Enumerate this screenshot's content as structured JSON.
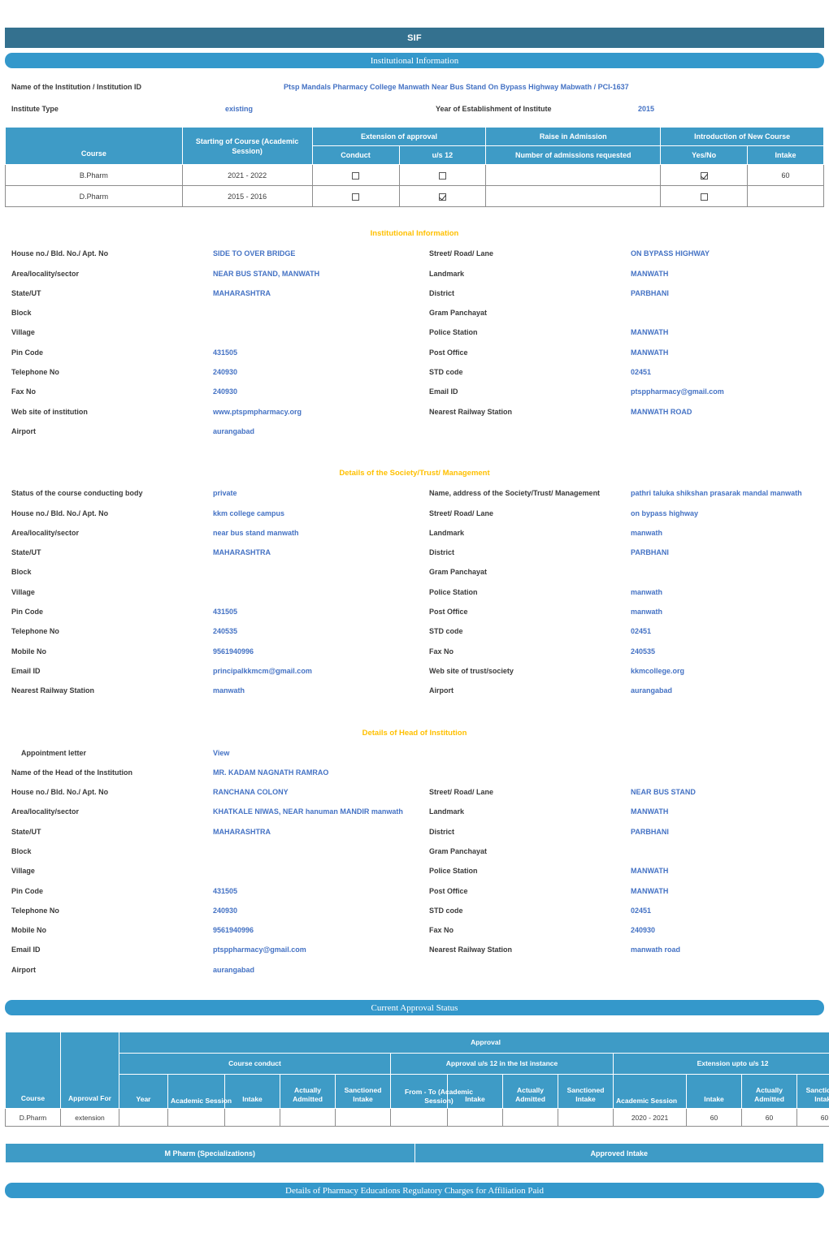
{
  "header": {
    "app_title": "SIF",
    "section_institutional": "Institutional Information"
  },
  "colors": {
    "title_bar": "#34718F",
    "section_bar": "#3498CB",
    "table_header": "#3E9BC6",
    "value_text": "#4472C4",
    "section_heading": "#FFC000",
    "link": "#4EA3D6"
  },
  "top": {
    "institution_label": "Name of the Institution / Institution ID",
    "institution_value": "Ptsp Mandals Pharmacy College Manwath Near Bus Stand On Bypass Highway Mabwath / PCI-1637",
    "institute_type_label": "Institute Type",
    "institute_type_value": "existing",
    "year_label": "Year of Establishment of Institute",
    "year_value": "2015"
  },
  "course_table": {
    "headers": {
      "course": "Course",
      "starting": "Starting of Course (Academic Session)",
      "extension": "Extension of approval",
      "conduct": "Conduct",
      "us12": "u/s 12",
      "raise": "Raise in Admission",
      "admissions_requested": "Number of admissions requested",
      "new_course": "Introduction of New Course",
      "yesno": "Yes/No",
      "intake": "Intake"
    },
    "rows": [
      {
        "course": "B.Pharm",
        "session": "2021 - 2022",
        "conduct": false,
        "us12": false,
        "admissions": "",
        "yesno": true,
        "intake": "60"
      },
      {
        "course": "D.Pharm",
        "session": "2015 - 2016",
        "conduct": false,
        "us12": true,
        "admissions": "",
        "yesno": false,
        "intake": ""
      }
    ]
  },
  "institutional_information": {
    "heading": "Institutional Information",
    "rows": [
      {
        "l1": "House no./ Bld. No./ Apt. No",
        "v1": "SIDE TO OVER BRIDGE",
        "l2": "Street/ Road/ Lane",
        "v2": "ON BYPASS HIGHWAY"
      },
      {
        "l1": "Area/locality/sector",
        "v1": "NEAR BUS STAND, MANWATH",
        "l2": "Landmark",
        "v2": "MANWATH"
      },
      {
        "l1": "State/UT",
        "v1": "MAHARASHTRA",
        "l2": "District",
        "v2": "PARBHANI"
      },
      {
        "l1": "Block",
        "v1": "",
        "l2": "Gram Panchayat",
        "v2": ""
      },
      {
        "l1": "Village",
        "v1": "",
        "l2": "Police Station",
        "v2": "MANWATH"
      },
      {
        "l1": "Pin Code",
        "v1": "431505",
        "l2": "Post Office",
        "v2": "MANWATH"
      },
      {
        "l1": "Telephone No",
        "v1": "240930",
        "l2": "STD code",
        "v2": "02451"
      },
      {
        "l1": "Fax No",
        "v1": "240930",
        "l2": "Email ID",
        "v2": "ptsppharmacy@gmail.com"
      },
      {
        "l1": "Web site of institution",
        "v1": "www.ptspmpharmacy.org",
        "l2": "Nearest Railway Station",
        "v2": "MANWATH ROAD"
      },
      {
        "l1": "Airport",
        "v1": "aurangabad",
        "l2": "",
        "v2": ""
      }
    ]
  },
  "society_details": {
    "heading": "Details of the Society/Trust/ Management",
    "rows": [
      {
        "l1": "Status of the course conducting body",
        "v1": "private",
        "l2": "Name, address of the Society/Trust/ Management",
        "v2": "pathri taluka shikshan prasarak mandal manwath"
      },
      {
        "l1": "House no./ Bld. No./ Apt. No",
        "v1": "kkm college campus",
        "l2": "Street/ Road/ Lane",
        "v2": "on bypass highway"
      },
      {
        "l1": "Area/locality/sector",
        "v1": "near bus stand manwath",
        "l2": "Landmark",
        "v2": "manwath"
      },
      {
        "l1": "State/UT",
        "v1": "MAHARASHTRA",
        "l2": "District",
        "v2": "PARBHANI"
      },
      {
        "l1": "Block",
        "v1": "",
        "l2": "Gram Panchayat",
        "v2": ""
      },
      {
        "l1": "Village",
        "v1": "",
        "l2": "Police Station",
        "v2": "manwath"
      },
      {
        "l1": "Pin Code",
        "v1": "431505",
        "l2": "Post Office",
        "v2": "manwath"
      },
      {
        "l1": "Telephone No",
        "v1": "240535",
        "l2": "STD code",
        "v2": "02451"
      },
      {
        "l1": "Mobile No",
        "v1": "9561940996",
        "l2": "Fax No",
        "v2": "240535"
      },
      {
        "l1": "Email ID",
        "v1": "principalkkmcm@gmail.com",
        "l2": "Web site of trust/society",
        "v2": "kkmcollege.org"
      },
      {
        "l1": "Nearest Railway Station",
        "v1": "manwath",
        "l2": "Airport",
        "v2": "aurangabad"
      }
    ]
  },
  "head_details": {
    "heading": "Details of Head of Institution",
    "appointment_letter_label": "Appointment letter",
    "appointment_letter_link": "View",
    "rows": [
      {
        "l1": "Name of the Head of the Institution",
        "v1": "MR. KADAM NAGNATH RAMRAO",
        "l2": "",
        "v2": ""
      },
      {
        "l1": "House no./ Bld. No./ Apt. No",
        "v1": "RANCHANA COLONY",
        "l2": "Street/ Road/ Lane",
        "v2": "NEAR BUS STAND"
      },
      {
        "l1": "Area/locality/sector",
        "v1": "KHATKALE NIWAS, NEAR hanuman MANDIR manwath",
        "l2": "Landmark",
        "v2": "MANWATH"
      },
      {
        "l1": "State/UT",
        "v1": "MAHARASHTRA",
        "l2": "District",
        "v2": "PARBHANI"
      },
      {
        "l1": "Block",
        "v1": "",
        "l2": "Gram Panchayat",
        "v2": ""
      },
      {
        "l1": "Village",
        "v1": "",
        "l2": "Police Station",
        "v2": "MANWATH"
      },
      {
        "l1": "Pin Code",
        "v1": "431505",
        "l2": "Post Office",
        "v2": "MANWATH"
      },
      {
        "l1": "Telephone No",
        "v1": "240930",
        "l2": "STD code",
        "v2": "02451"
      },
      {
        "l1": "Mobile No",
        "v1": "9561940996",
        "l2": "Fax No",
        "v2": "240930"
      },
      {
        "l1": "Email ID",
        "v1": "ptsppharmacy@gmail.com",
        "l2": "Nearest Railway Station",
        "v2": "manwath road"
      },
      {
        "l1": "Airport",
        "v1": "aurangabad",
        "l2": "",
        "v2": ""
      }
    ]
  },
  "approval_status": {
    "bar_label": "Current Approval Status",
    "headers": {
      "course": "Course",
      "approval_for": "Approval For",
      "approval": "Approval",
      "course_conduct": "Course conduct",
      "approval_us12_first": "Approval u/s 12 in the lst instance",
      "extension_upto": "Extension upto u/s 12",
      "year": "Year",
      "academic_session": "Academic Session",
      "intake": "Intake",
      "actually_admitted": "Actually Admitted",
      "sanctioned_intake": "Sanctioned Intake",
      "from_to": "From - To (Academic Session)"
    },
    "rows": [
      {
        "course": "D.Pharm",
        "approval_for": "extension",
        "cc_year": "",
        "cc_session": "",
        "cc_intake": "",
        "cc_admitted": "",
        "cc_sanctioned": "",
        "a12_fromto": "",
        "a12_intake": "",
        "a12_admitted": "",
        "a12_sanctioned": "",
        "ext_session": "2020 - 2021",
        "ext_intake": "60",
        "ext_admitted": "60",
        "ext_sanctioned": "60"
      }
    ]
  },
  "mpharm": {
    "specializations_label": "M Pharm (Specializations)",
    "approved_intake_label": "Approved Intake"
  },
  "footer": {
    "regulatory_charges_bar": "Details of Pharmacy Educations Regulatory Charges for Affiliation Paid"
  }
}
